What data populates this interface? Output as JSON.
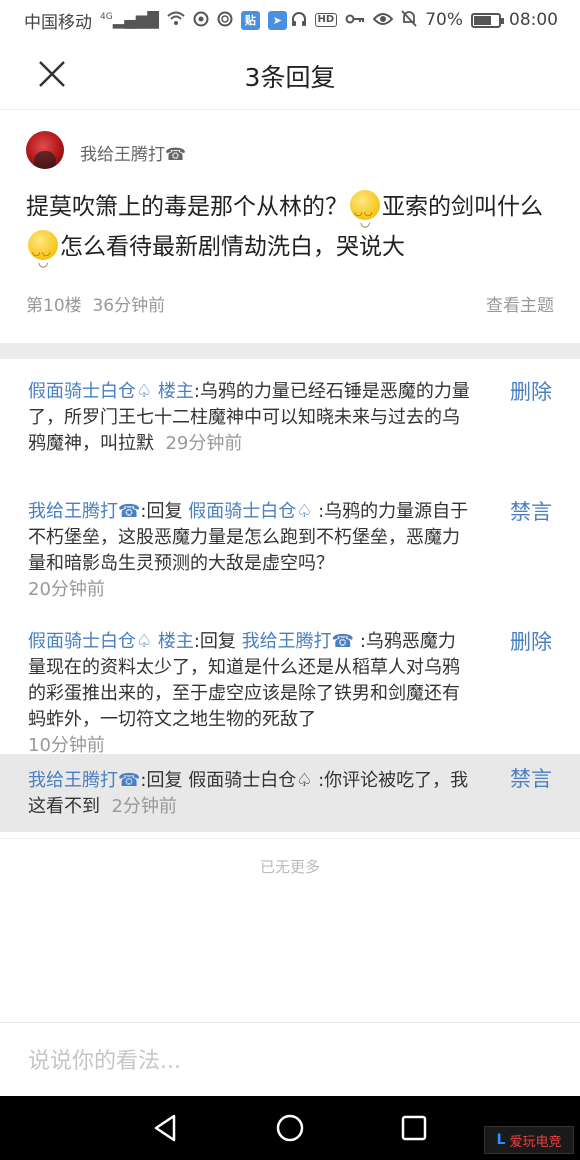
{
  "status_bar": {
    "carrier": "中国移动",
    "network": "4G",
    "battery_percent": "70%",
    "time": "08:00",
    "battery_level": 0.7
  },
  "header": {
    "title": "3条回复"
  },
  "post": {
    "author": "我给王腾打☎",
    "text_part1": "提莫吹箫上的毒是那个从林的？",
    "text_part2": "亚索的剑叫什么",
    "text_part3": "怎么看待最新剧情劫洗白，哭说大",
    "floor": "第10楼",
    "time": "36分钟前",
    "view_topic": "查看主题"
  },
  "replies": [
    {
      "user": "假面骑士白仓♤ 楼主",
      "content": ":乌鸦的力量已经石锤是恶魔的力量了，所罗门王七十二柱魔神中可以知晓未来与过去的乌鸦魔神，叫拉默",
      "time": "29分钟前",
      "action": "删除"
    },
    {
      "user": "我给王腾打☎",
      "reply_word": ":回复",
      "target": "假面骑士白仓♤",
      "content": ":乌鸦的力量源自于不朽堡垒，这股恶魔力量是怎么跑到不朽堡垒，恶魔力量和暗影岛生灵预测的大敌是虚空吗？",
      "time": "20分钟前",
      "action": "禁言"
    },
    {
      "user": "假面骑士白仓♤ 楼主",
      "reply_word": ":回复",
      "target": "我给王腾打☎",
      "content": ":乌鸦恶魔力量现在的资料太少了，知道是什么还是从稻草人对乌鸦的彩蛋推出来的，至于虚空应该是除了铁男和剑魔还有蚂蚱外，一切符文之地生物的死敌了",
      "time": "10分钟前",
      "action": "删除"
    },
    {
      "user": "我给王腾打☎",
      "reply_word": ":回复",
      "target": "假面骑士白仓♤",
      "content": ":你评论被吃了，我这看不到",
      "time": "2分钟前",
      "action": "禁言"
    }
  ],
  "no_more": "已无更多",
  "comment_input": {
    "placeholder": "说说你的看法..."
  },
  "watermark": {
    "text": "爱玩电竞"
  },
  "colors": {
    "link_blue": "#4a7fc1",
    "meta_gray": "#999999",
    "highlight_bg": "#e8e8e8"
  },
  "icons": [
    "close-icon",
    "back-triangle-icon",
    "home-circle-icon",
    "recent-square-icon",
    "wifi-icon",
    "signal-icon",
    "battery-icon",
    "headphone-icon",
    "key-icon",
    "eye-icon",
    "mute-icon"
  ]
}
